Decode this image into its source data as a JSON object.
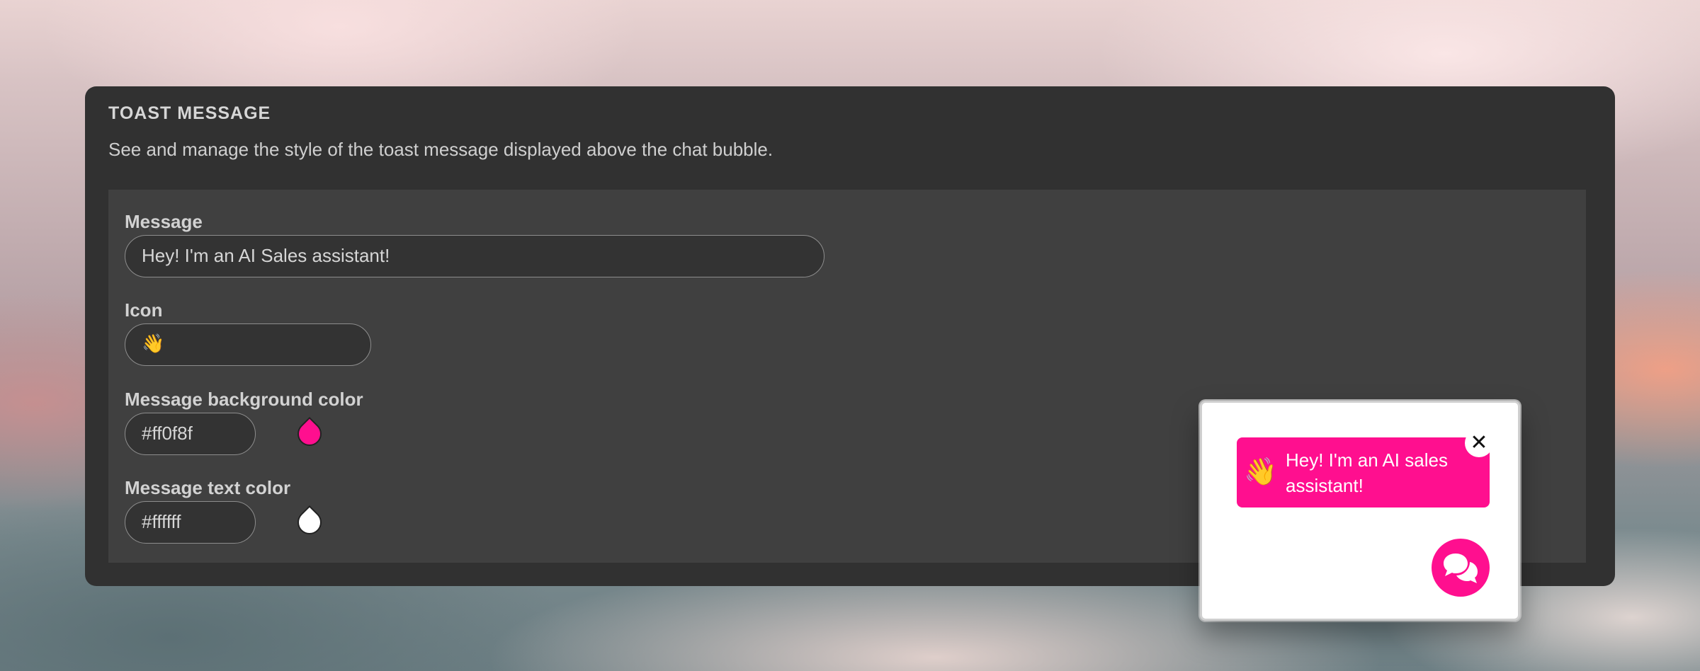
{
  "section": {
    "title": "TOAST MESSAGE",
    "description": "See and manage the style of the toast message displayed above the chat bubble."
  },
  "fields": {
    "message": {
      "label": "Message",
      "value": "Hey! I'm an AI Sales assistant!"
    },
    "icon": {
      "label": "Icon",
      "value": "👋"
    },
    "background_color": {
      "label": "Message background color",
      "value": "#ff0f8f",
      "swatch_color": "#ff0f8f"
    },
    "text_color": {
      "label": "Message text color",
      "value": "#ffffff",
      "swatch_color": "#ffffff"
    }
  },
  "preview": {
    "toast_icon": "👋",
    "toast_text": "Hey! I'm an AI sales assistant!",
    "close_glyph": "✕",
    "close_icon": "close-icon",
    "chat_icon": "chat-bubbles-icon",
    "accent_color": "#ff0f8f"
  }
}
